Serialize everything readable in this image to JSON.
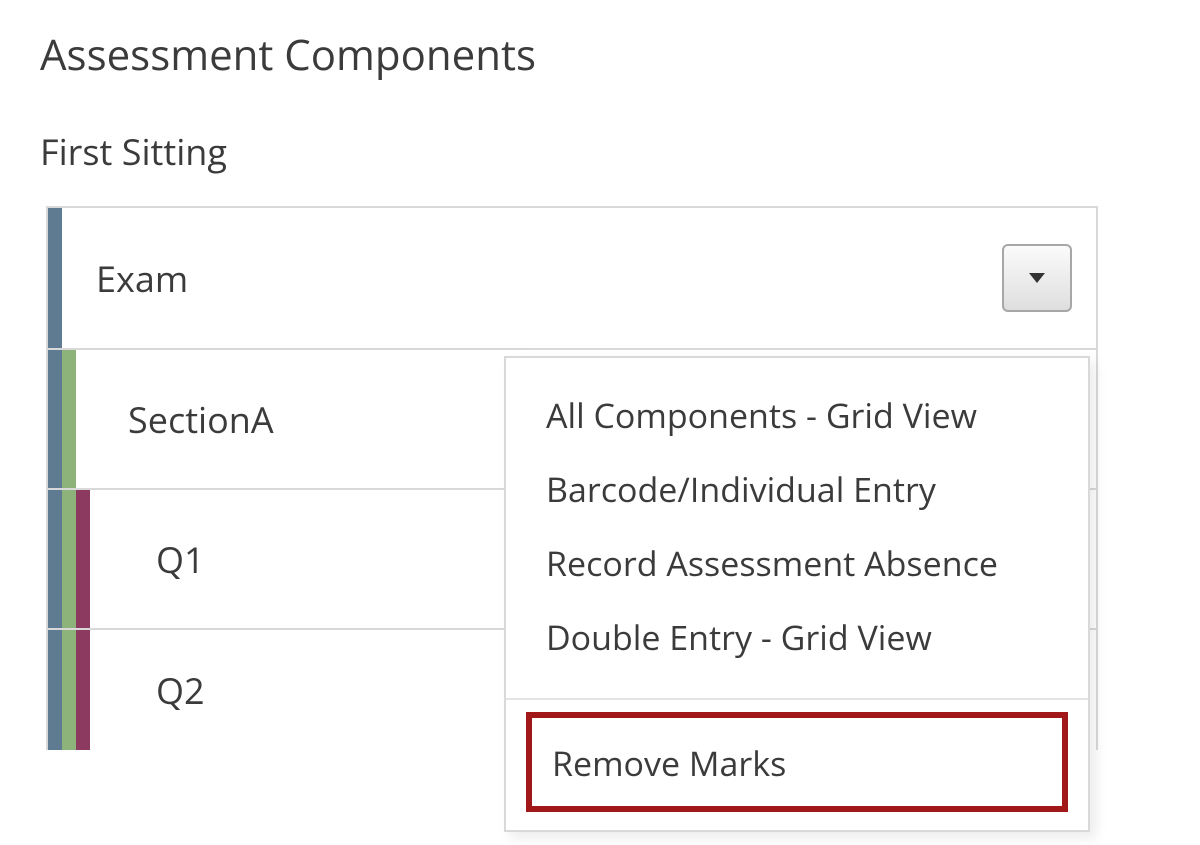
{
  "page_title": "Assessment Components",
  "subtitle": "First Sitting",
  "rows": {
    "exam": "Exam",
    "sectionA": "SectionA",
    "q1": "Q1",
    "q2": "Q2"
  },
  "menu": {
    "group1": [
      "All Components - Grid View",
      "Barcode/Individual Entry",
      "Record Assessment Absence",
      "Double Entry - Grid View"
    ],
    "remove": "Remove Marks"
  },
  "colors": {
    "blue": "#5e7b91",
    "green": "#8eb37a",
    "magenta": "#8d3a61",
    "highlight_border": "#a21717"
  }
}
